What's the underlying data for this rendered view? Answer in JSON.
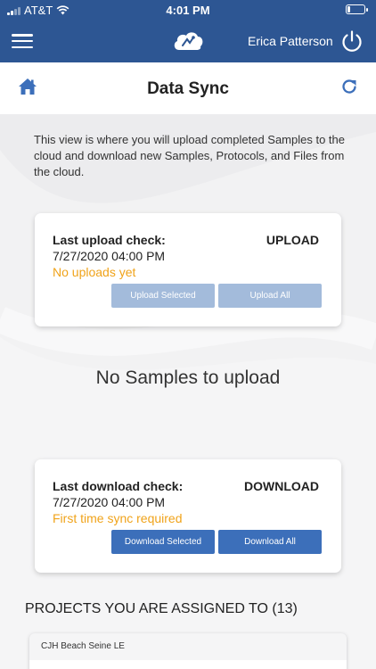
{
  "status_bar": {
    "carrier": "AT&T",
    "time": "4:01 PM"
  },
  "header": {
    "user_name": "Erica Patterson"
  },
  "page": {
    "title": "Data Sync"
  },
  "intro": {
    "text": "This view is where you will upload completed Samples to the cloud and download new Samples, Protocols, and Files from the cloud."
  },
  "upload_card": {
    "label": "Last upload check:",
    "date": "7/27/2020 04:00 PM",
    "status": "No uploads yet",
    "heading": "UPLOAD",
    "selected_button": "Upload Selected",
    "all_button": "Upload All"
  },
  "empty_state": {
    "text": "No Samples to upload"
  },
  "download_card": {
    "label": "Last download check:",
    "date": "7/27/2020 04:00 PM",
    "status": "First time sync required",
    "heading": "DOWNLOAD",
    "selected_button": "Download Selected",
    "all_button": "Download All"
  },
  "projects": {
    "header": "PROJECTS YOU ARE ASSIGNED TO (13)",
    "items": [
      {
        "name": "CJH Beach Seine LE"
      }
    ]
  },
  "icons": {
    "menu": "hamburger-menu-icon",
    "logo": "cloud-logo-icon",
    "power": "power-icon",
    "home": "home-icon",
    "refresh": "refresh-icon"
  },
  "colors": {
    "brand_blue": "#2d5693",
    "button_active": "#3c6fba",
    "button_disabled": "#a3bbdb",
    "status_orange": "#f0a31a"
  }
}
